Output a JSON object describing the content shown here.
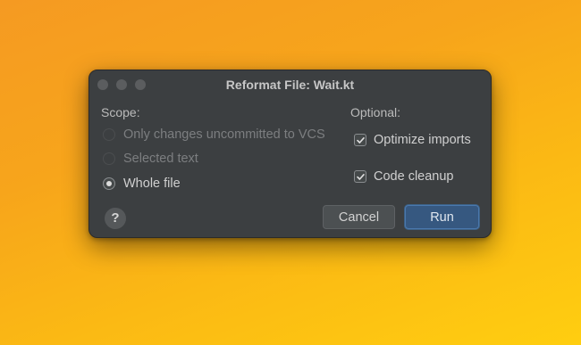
{
  "dialog": {
    "title": "Reformat File: Wait.kt",
    "scope": {
      "label": "Scope:",
      "options": [
        {
          "label": "Only changes uncommitted to VCS",
          "selected": false,
          "enabled": false
        },
        {
          "label": "Selected text",
          "selected": false,
          "enabled": false
        },
        {
          "label": "Whole file",
          "selected": true,
          "enabled": true
        }
      ]
    },
    "optional": {
      "label": "Optional:",
      "options": [
        {
          "label": "Optimize imports",
          "checked": true
        },
        {
          "label": "Code cleanup",
          "checked": true
        }
      ]
    },
    "buttons": {
      "help": "?",
      "cancel": "Cancel",
      "run": "Run"
    }
  },
  "colors": {
    "background_top": "#f59a22",
    "background_bottom": "#ffce10",
    "dialog_bg": "#3c3f41",
    "primary_button": "#365880"
  }
}
